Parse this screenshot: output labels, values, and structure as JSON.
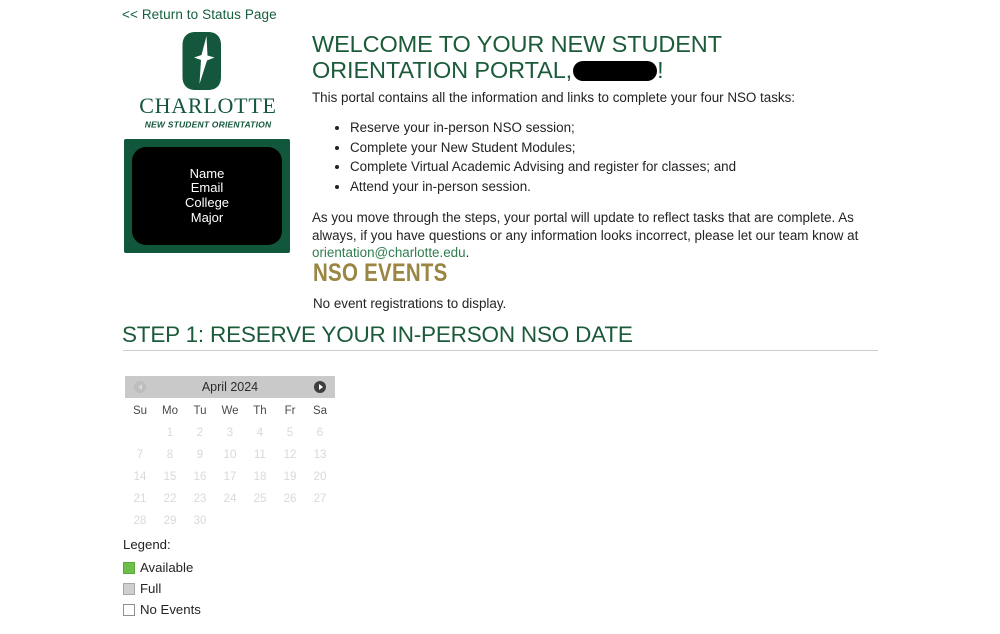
{
  "nav": {
    "return_link": "<< Return to Status Page"
  },
  "logo": {
    "wordmark": "CHARLOTTE",
    "subtitle": "NEW STUDENT ORIENTATION",
    "brand_green": "#14573c"
  },
  "profile_card": {
    "lines": [
      "Name",
      "Email",
      "College",
      "Major"
    ],
    "border_color": "#11573b",
    "redaction_color": "#000000"
  },
  "main": {
    "welcome_heading_part1": "WELCOME TO YOUR NEW STUDENT ORIENTATION PORTAL,",
    "welcome_heading_part2": "!",
    "intro": "This portal contains all the information and links to complete your four NSO tasks:",
    "tasks": [
      "Reserve your in-person NSO session;",
      "Complete your New Student Modules;",
      "Complete Virtual Academic Advising and register for classes; and",
      "Attend your in-person session."
    ],
    "closing_before_link": "As you move through the steps, your portal will update to reflect tasks that are complete. As always, if you have questions or any information looks incorrect, please let our team know at ",
    "closing_link": "orientation@charlotte.edu",
    "closing_after_link": ".",
    "heading_color": "#1c5b3a",
    "link_color": "#2f7d4f"
  },
  "nso_events": {
    "heading": "NSO EVENTS",
    "empty_message": "No event registrations to display.",
    "heading_color": "#9a8542"
  },
  "step1": {
    "heading": "STEP 1: RESERVE YOUR IN-PERSON NSO DATE"
  },
  "calendar": {
    "title": "April 2024",
    "prev_label": "Previous month",
    "next_label": "Next month",
    "weekdays": [
      "Su",
      "Mo",
      "Tu",
      "We",
      "Th",
      "Fr",
      "Sa"
    ],
    "weeks": [
      [
        "",
        "1",
        "2",
        "3",
        "4",
        "5",
        "6"
      ],
      [
        "7",
        "8",
        "9",
        "10",
        "11",
        "12",
        "13"
      ],
      [
        "14",
        "15",
        "16",
        "17",
        "18",
        "19",
        "20"
      ],
      [
        "21",
        "22",
        "23",
        "24",
        "25",
        "26",
        "27"
      ],
      [
        "28",
        "29",
        "30",
        "",
        "",
        "",
        ""
      ]
    ]
  },
  "legend": {
    "title": "Legend:",
    "items": [
      {
        "label": "Available",
        "color": "#6cbf4a"
      },
      {
        "label": "Full",
        "color": "#cfcfcf"
      },
      {
        "label": "No Events",
        "color": "#ffffff"
      }
    ]
  }
}
